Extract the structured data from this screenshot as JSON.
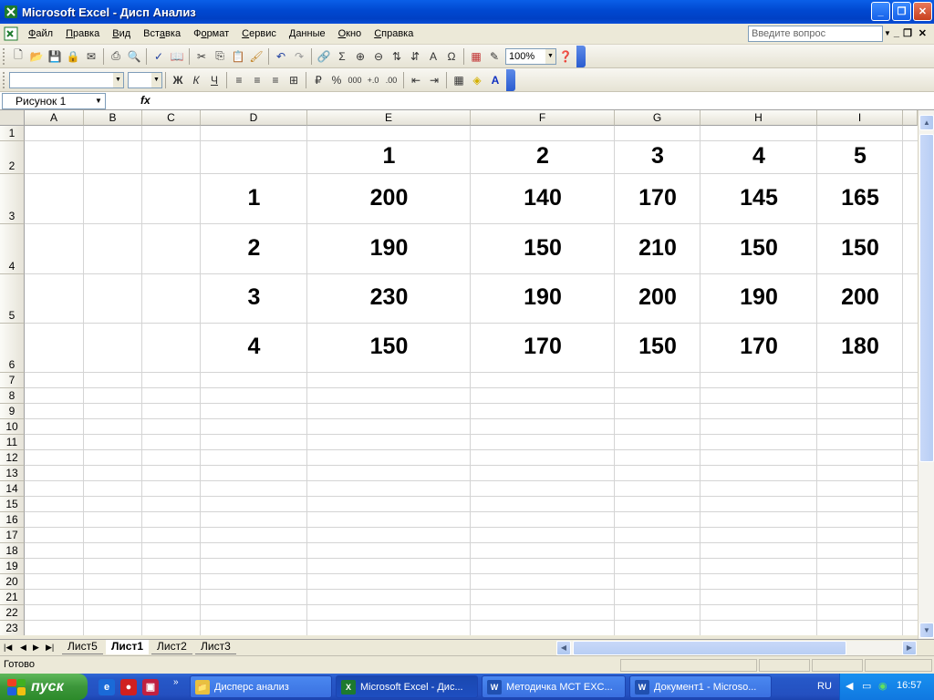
{
  "window": {
    "title": "Microsoft Excel - Дисп Анализ"
  },
  "menu": {
    "items": [
      {
        "pre": "",
        "u": "Ф",
        "post": "айл"
      },
      {
        "pre": "",
        "u": "П",
        "post": "равка"
      },
      {
        "pre": "",
        "u": "В",
        "post": "ид"
      },
      {
        "pre": "Вст",
        "u": "а",
        "post": "вка"
      },
      {
        "pre": "Ф",
        "u": "о",
        "post": "рмат"
      },
      {
        "pre": "",
        "u": "С",
        "post": "ервис"
      },
      {
        "pre": "",
        "u": "Д",
        "post": "анные"
      },
      {
        "pre": "",
        "u": "О",
        "post": "кно"
      },
      {
        "pre": "",
        "u": "С",
        "post": "правка"
      }
    ],
    "help_placeholder": "Введите вопрос"
  },
  "toolbar": {
    "zoom": "100%",
    "bold": "Ж",
    "italic": "К",
    "underline": "Ч",
    "percent": "%",
    "thousands": "000",
    "sum": "Σ",
    "omega": "Ω"
  },
  "formula_bar": {
    "name_box": "Рисунок 1",
    "fx": "fx"
  },
  "columns": [
    "A",
    "B",
    "C",
    "D",
    "E",
    "F",
    "G",
    "H",
    "I"
  ],
  "rows": [
    "1",
    "2",
    "3",
    "4",
    "5",
    "6",
    "7",
    "8",
    "9",
    "10",
    "11",
    "12",
    "13",
    "14",
    "15",
    "16",
    "17",
    "18",
    "19",
    "20",
    "21",
    "22",
    "23"
  ],
  "table": {
    "header": [
      "1",
      "2",
      "3",
      "4",
      "5"
    ],
    "row_labels": [
      "1",
      "2",
      "3",
      "4"
    ],
    "values": [
      [
        "200",
        "140",
        "170",
        "145",
        "165"
      ],
      [
        "190",
        "150",
        "210",
        "150",
        "150"
      ],
      [
        "230",
        "190",
        "200",
        "190",
        "200"
      ],
      [
        "150",
        "170",
        "150",
        "170",
        "180"
      ]
    ]
  },
  "sheet_tabs": [
    "Лист5",
    "Лист1",
    "Лист2",
    "Лист3"
  ],
  "active_tab": "Лист1",
  "status": {
    "text": "Готово"
  },
  "taskbar": {
    "start_label": "пуск",
    "tasks": [
      "Дисперс анализ",
      "Microsoft Excel - Дис...",
      "Методичка МСТ EXC...",
      "Документ1 - Microso..."
    ],
    "lang": "RU",
    "clock": "16:57"
  }
}
